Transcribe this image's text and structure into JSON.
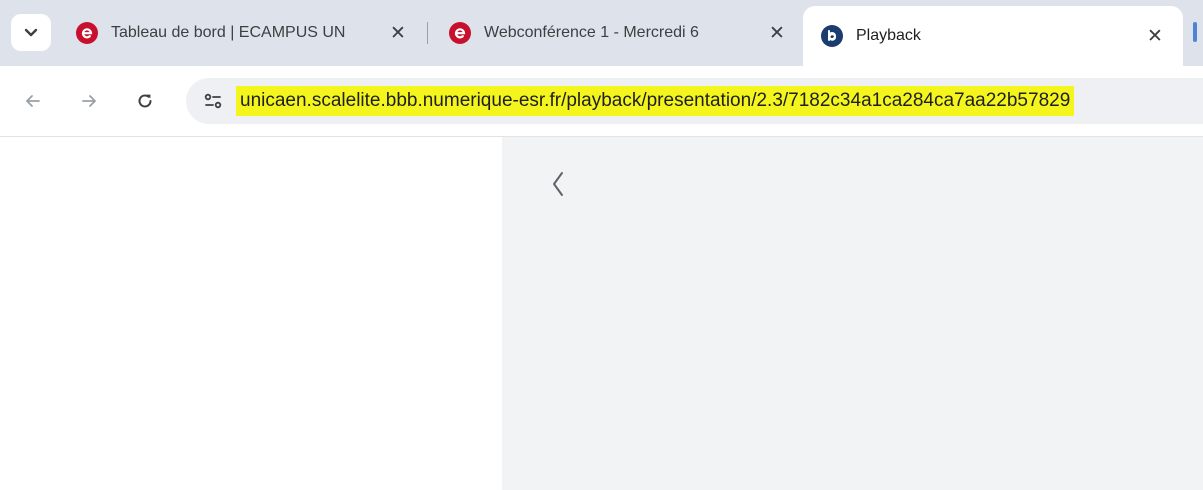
{
  "browser": {
    "tabs": [
      {
        "title": "Tableau de bord | ECAMPUS UN",
        "favicon": "ecampus-icon",
        "active": false
      },
      {
        "title": "Webconférence 1 - Mercredi 6",
        "favicon": "ecampus-icon",
        "active": false
      },
      {
        "title": "Playback",
        "favicon": "bigbluebutton-icon",
        "active": true
      }
    ],
    "close_glyph": "✕"
  },
  "toolbar": {
    "url": "unicaen.scalelite.bbb.numerique-esr.fr/playback/presentation/2.3/7182c34a1ca284ca7aa22b57829",
    "url_highlight_color": "#f5f51e"
  },
  "colors": {
    "tabstrip_bg": "#dee3eb",
    "content_right_bg": "#f2f3f5",
    "ecampus_red": "#c8102e",
    "bbb_blue": "#1b3c6e"
  }
}
